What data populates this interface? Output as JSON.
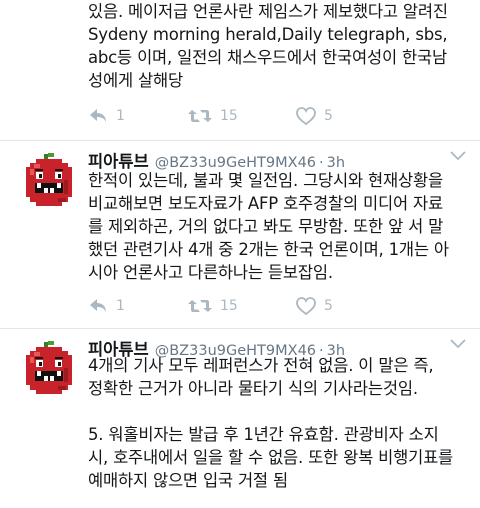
{
  "tweets": [
    {
      "text": "있음. 메이저급 언론사란 제임스가 제보했다고 알려진\nSydeny morning herald,Daily telegraph, sbs,\nabc등 이며, 일전의 채스우드에서 한국여성이 한국남\n성에게 살해당",
      "reply_count": "1",
      "retweet_count": "15",
      "like_count": "5"
    },
    {
      "author_name": "피아튜브",
      "author_handle": "@BZ33u9GeHT9MX46",
      "separator": "·",
      "time": "3h",
      "text": "한적이 있는데, 불과 몇 일전임. 그당시와 현재상황을\n비교해보면 보도자료가 AFP 호주경찰의 미디어 자료\n를 제외하곤, 거의 없다고 봐도 무방함. 또한 앞 서 말\n했던 관련기사 4개 중 2개는 한국 언론이며, 1개는 아\n시아 언론사고 다른하나는 듣보잡임.",
      "reply_count": "1",
      "retweet_count": "15",
      "like_count": "5"
    },
    {
      "author_name": "피아튜브",
      "author_handle": "@BZ33u9GeHT9MX46",
      "separator": "·",
      "time": "3h",
      "text": "4개의 기사 모두 레퍼런스가 전혀 없음. 이 말은 즉,\n정확한 근거가 아니라 물타기 식의 기사라는것임.\n\n5. 워홀비자는 발급 후 1년간 유효함. 관광비자 소지\n시, 호주내에서 일을 할 수 없음. 또한 왕복 비행기표를\n예매하지 않으면 입국 거절 됨"
    }
  ],
  "icons": {
    "reply": "reply-icon",
    "retweet": "retweet-icon",
    "like": "heart-icon",
    "more": "chevron-down-icon",
    "avatar": "red-pixel-monster-avatar"
  },
  "colors": {
    "text": "#14171a",
    "meta": "#657786",
    "action": "#aab8c2",
    "divider": "#e1e8ed",
    "avatar_red": "#c8232a"
  }
}
